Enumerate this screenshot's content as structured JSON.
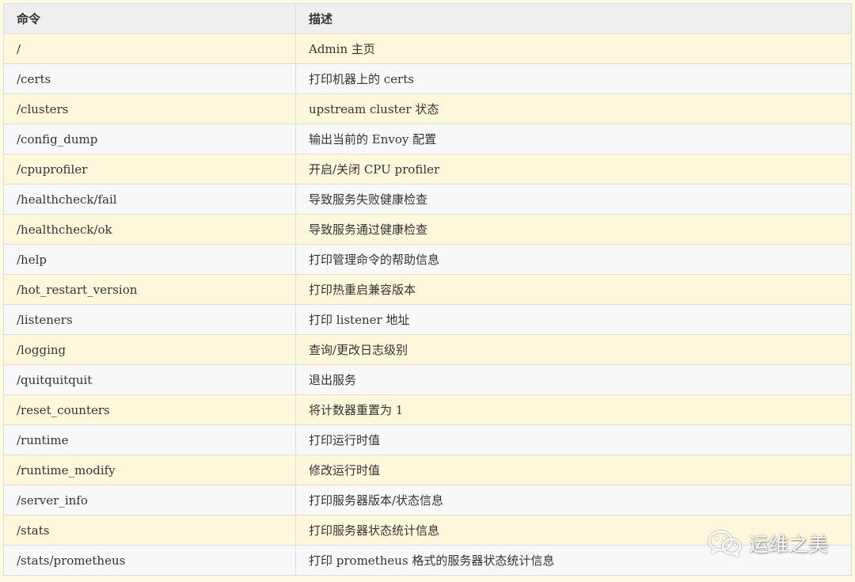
{
  "table": {
    "headers": [
      "命令",
      "描述"
    ],
    "rows": [
      [
        "/",
        "Admin 主页"
      ],
      [
        "/certs",
        "打印机器上的 certs"
      ],
      [
        "/clusters",
        "upstream cluster 状态"
      ],
      [
        "/config_dump",
        "输出当前的 Envoy 配置"
      ],
      [
        "/cpuprofiler",
        "开启/关闭 CPU profiler"
      ],
      [
        "/healthcheck/fail",
        "导致服务失败健康检查"
      ],
      [
        "/healthcheck/ok",
        "导致服务通过健康检查"
      ],
      [
        "/help",
        "打印管理命令的帮助信息"
      ],
      [
        "/hot_restart_version",
        "打印热重启兼容版本"
      ],
      [
        "/listeners",
        "打印 listener 地址"
      ],
      [
        "/logging",
        "查询/更改日志级别"
      ],
      [
        "/quitquitquit",
        "退出服务"
      ],
      [
        "/reset_counters",
        "将计数器重置为 1"
      ],
      [
        "/runtime",
        "打印运行时值"
      ],
      [
        "/runtime_modify",
        "修改运行时值"
      ],
      [
        "/server_info",
        "打印服务器版本/状态信息"
      ],
      [
        "/stats",
        "打印服务器状态统计信息"
      ],
      [
        "/stats/prometheus",
        "打印 prometheus 格式的服务器状态统计信息"
      ]
    ]
  },
  "watermark": {
    "text": "运维之美",
    "icon": "wechat-icon"
  }
}
